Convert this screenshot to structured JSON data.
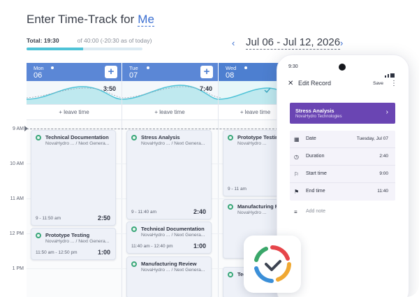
{
  "header": {
    "title_prefix": "Enter Time-Track for",
    "title_user": "Me",
    "total_label": "Total: 19:30",
    "total_sub": "of 40:00 (-20:30 as of today)",
    "progress_fraction": 0.49,
    "date_range": "Jul 06 - Jul 12, 2026",
    "prev_icon": "chevron-left-icon",
    "next_icon": "chevron-right-icon"
  },
  "colors": {
    "accent": "#3b6fd1",
    "header_bg": "#5b87d6",
    "wave": "#4fc3d7",
    "project": "#6a45b3"
  },
  "days": [
    {
      "dow": "Mon",
      "dom": "06",
      "total": "3:50",
      "leave": "+ leave time"
    },
    {
      "dow": "Tue",
      "dom": "07",
      "total": "7:40",
      "leave": "+ leave time"
    },
    {
      "dow": "Wed",
      "dom": "08",
      "total": "",
      "leave": "+ leave time"
    }
  ],
  "plus_label": "+",
  "time_labels": [
    "9 AM",
    "10 AM",
    "11 AM",
    "12 PM",
    "1 PM"
  ],
  "entries": {
    "mon_1": {
      "title": "Technical Documentation",
      "sub": "NovaHydro ... / Next Genera...",
      "time": "9 - 11:50 am",
      "dur": "2:50"
    },
    "mon_2": {
      "title": "Prototype Testing",
      "sub": "NovaHydro ... / Next Genera...",
      "time": "11:50 am - 12:50 pm",
      "dur": "1:00"
    },
    "tue_1": {
      "title": "Stress Analysis",
      "sub": "NovaHydro ... / Next Genera...",
      "time": "9 - 11:40 am",
      "dur": "2:40"
    },
    "tue_2": {
      "title": "Technical Documentation",
      "sub": "NovaHydro ... / Next Genera...",
      "time": "11:40 am - 12:40 pm",
      "dur": "1:00"
    },
    "tue_3": {
      "title": "Manufacturing Review",
      "sub": "NovaHydro ... / Next Genera..."
    },
    "wed_1": {
      "title": "Prototype Testing",
      "sub": "NovaHydro ...",
      "time": "9 - 11 am"
    },
    "wed_2": {
      "title": "Manufacturing Review",
      "sub": "NovaHydro ..."
    },
    "wed_3": {
      "title": "Technical",
      "sub": ""
    }
  },
  "phone": {
    "status_time": "9:30",
    "title": "Edit Record",
    "save": "Save",
    "more": "⋮",
    "close": "✕",
    "project_name": "Stress Analysis",
    "project_client": "NovaHydro Technologies",
    "fields": [
      {
        "icon": "calendar-icon",
        "glyph": "▦",
        "label": "Date",
        "value": "Tuesday, Jul 07"
      },
      {
        "icon": "clock-icon",
        "glyph": "◷",
        "label": "Duration",
        "value": "2:40"
      },
      {
        "icon": "flag-start-icon",
        "glyph": "⚐",
        "label": "Start time",
        "value": "9:00"
      },
      {
        "icon": "flag-end-icon",
        "glyph": "⚑",
        "label": "End time",
        "value": "11:40"
      }
    ],
    "note_placeholder": "Add note"
  }
}
